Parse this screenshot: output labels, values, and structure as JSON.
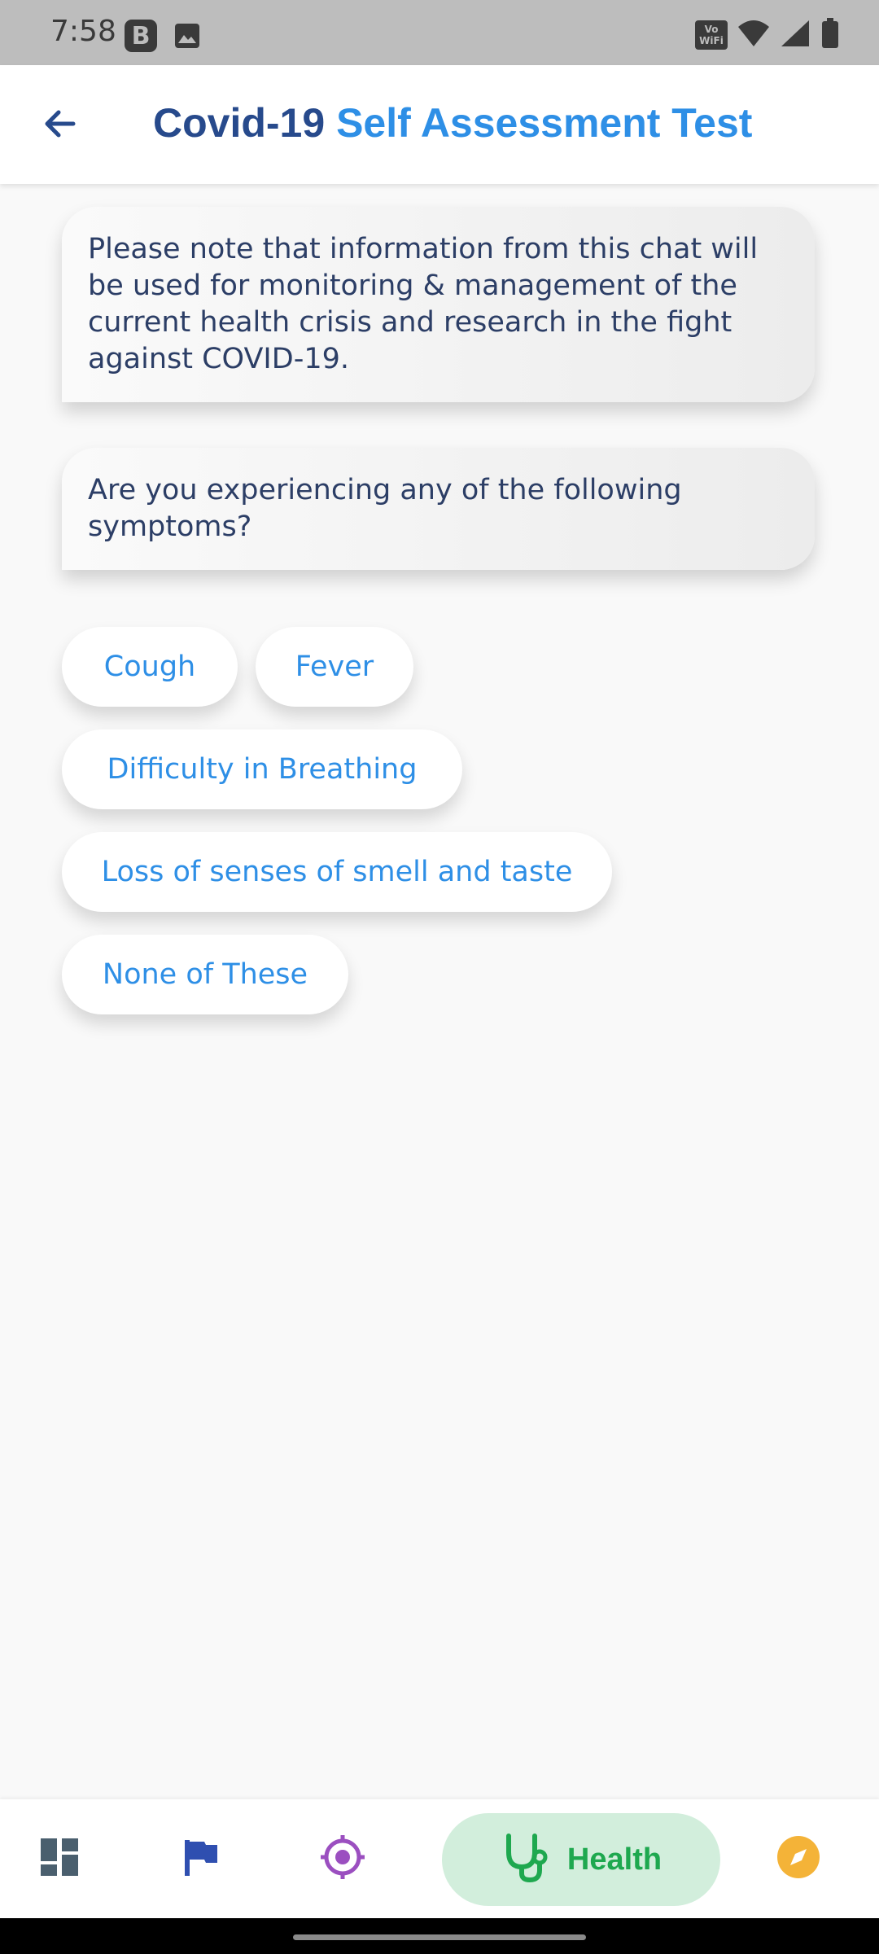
{
  "status_bar": {
    "time": "7:58",
    "b_badge": "B",
    "wifi_badge_top": "Vo",
    "wifi_badge_bottom": "WiFi",
    "icons": [
      "b-app-icon",
      "image-icon",
      "vowifi-icon",
      "wifi-icon",
      "signal-icon",
      "battery-icon"
    ]
  },
  "app_bar": {
    "back_icon": "back-arrow-icon",
    "title_part1": "Covid-19",
    "title_part2": "Self Assessment Test",
    "title_color_dark": "#274a8c",
    "title_color_accent": "#2e8fe6"
  },
  "chat": {
    "messages": [
      "Please note that information from this chat will be used for monitoring & management of the current health crisis and research in the fight against COVID-19.",
      "Are you experiencing any of the following symptoms?"
    ],
    "options": [
      "Cough",
      "Fever",
      "Difficulty in Breathing",
      "Loss of senses of smell and taste",
      "None of These"
    ]
  },
  "bottom_nav": {
    "items": [
      {
        "icon": "dashboard-icon",
        "color": "#4a5f6e"
      },
      {
        "icon": "flag-icon",
        "color": "#2f4fb0"
      },
      {
        "icon": "target-icon",
        "color": "#9b4fc0"
      },
      {
        "icon": "stethoscope-icon",
        "label": "Health",
        "color": "#1ea84f",
        "active": true
      },
      {
        "icon": "compass-icon",
        "color": "#f4b338"
      }
    ]
  }
}
